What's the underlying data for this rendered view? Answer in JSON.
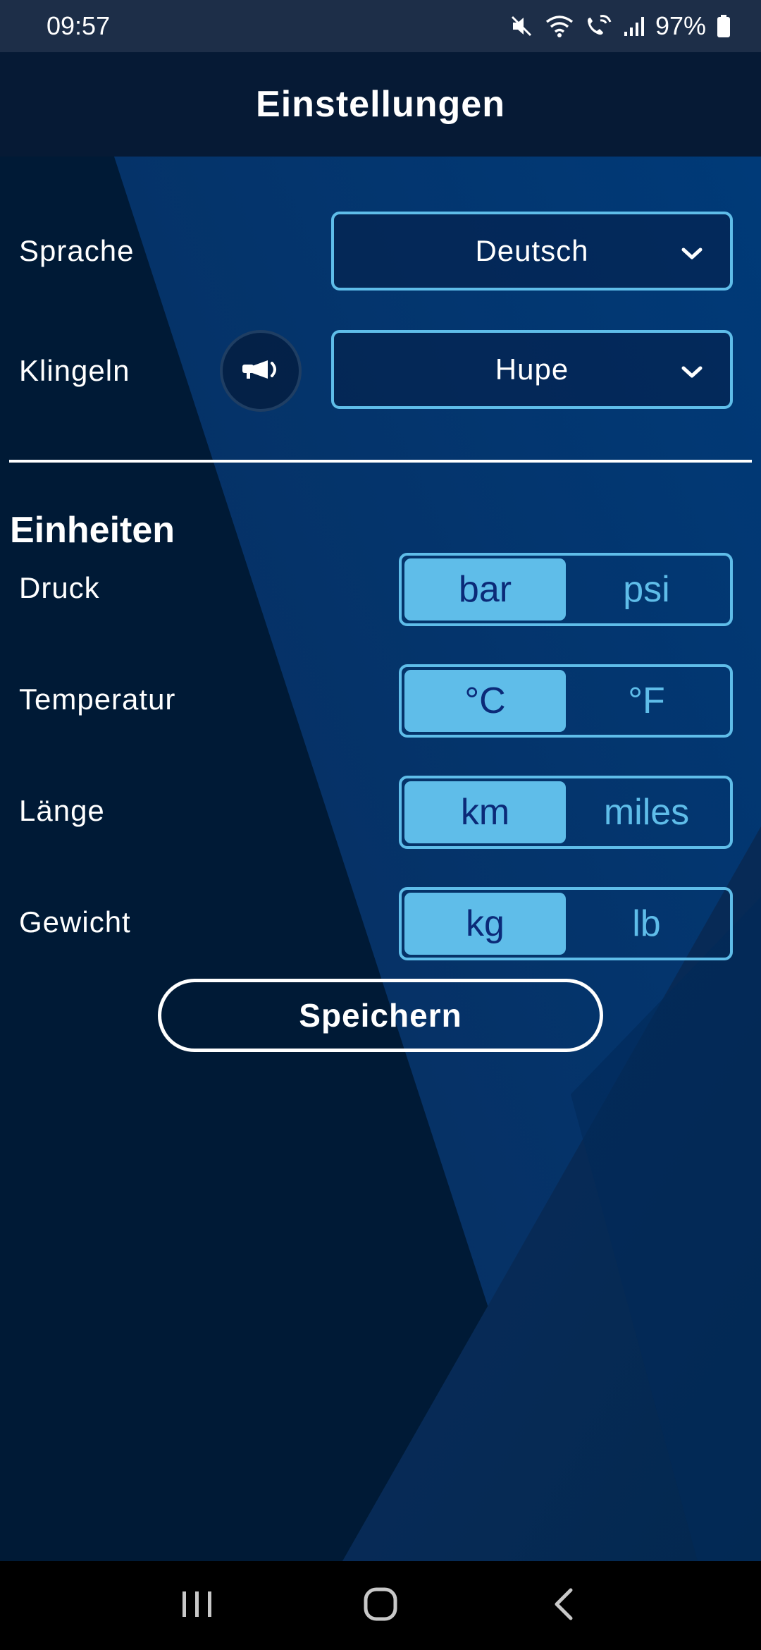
{
  "status_bar": {
    "time": "09:57",
    "battery": "97%",
    "icons": [
      "mute-icon",
      "wifi-icon",
      "wifi-call-icon",
      "signal-icon",
      "battery-icon"
    ]
  },
  "header": {
    "title": "Einstellungen"
  },
  "settings": {
    "language": {
      "label": "Sprache",
      "value": "Deutsch"
    },
    "ring": {
      "label": "Klingeln",
      "value": "Hupe",
      "icon": "horn-icon"
    }
  },
  "units": {
    "title": "Einheiten",
    "pressure": {
      "label": "Druck",
      "options": [
        "bar",
        "psi"
      ],
      "selected": "bar"
    },
    "temperature": {
      "label": "Temperatur",
      "options": [
        "°C",
        "°F"
      ],
      "selected": "°C"
    },
    "length": {
      "label": "Länge",
      "options": [
        "km",
        "miles"
      ],
      "selected": "km"
    },
    "weight": {
      "label": "Gewicht",
      "options": [
        "kg",
        "lb"
      ],
      "selected": "kg"
    }
  },
  "actions": {
    "save_label": "Speichern"
  },
  "colors": {
    "accent": "#5fbde9",
    "header_bg": "#061a35",
    "selected_text": "#0b2a78"
  },
  "navbar": {
    "icons": [
      "recent-apps-icon",
      "home-icon",
      "back-icon"
    ]
  }
}
